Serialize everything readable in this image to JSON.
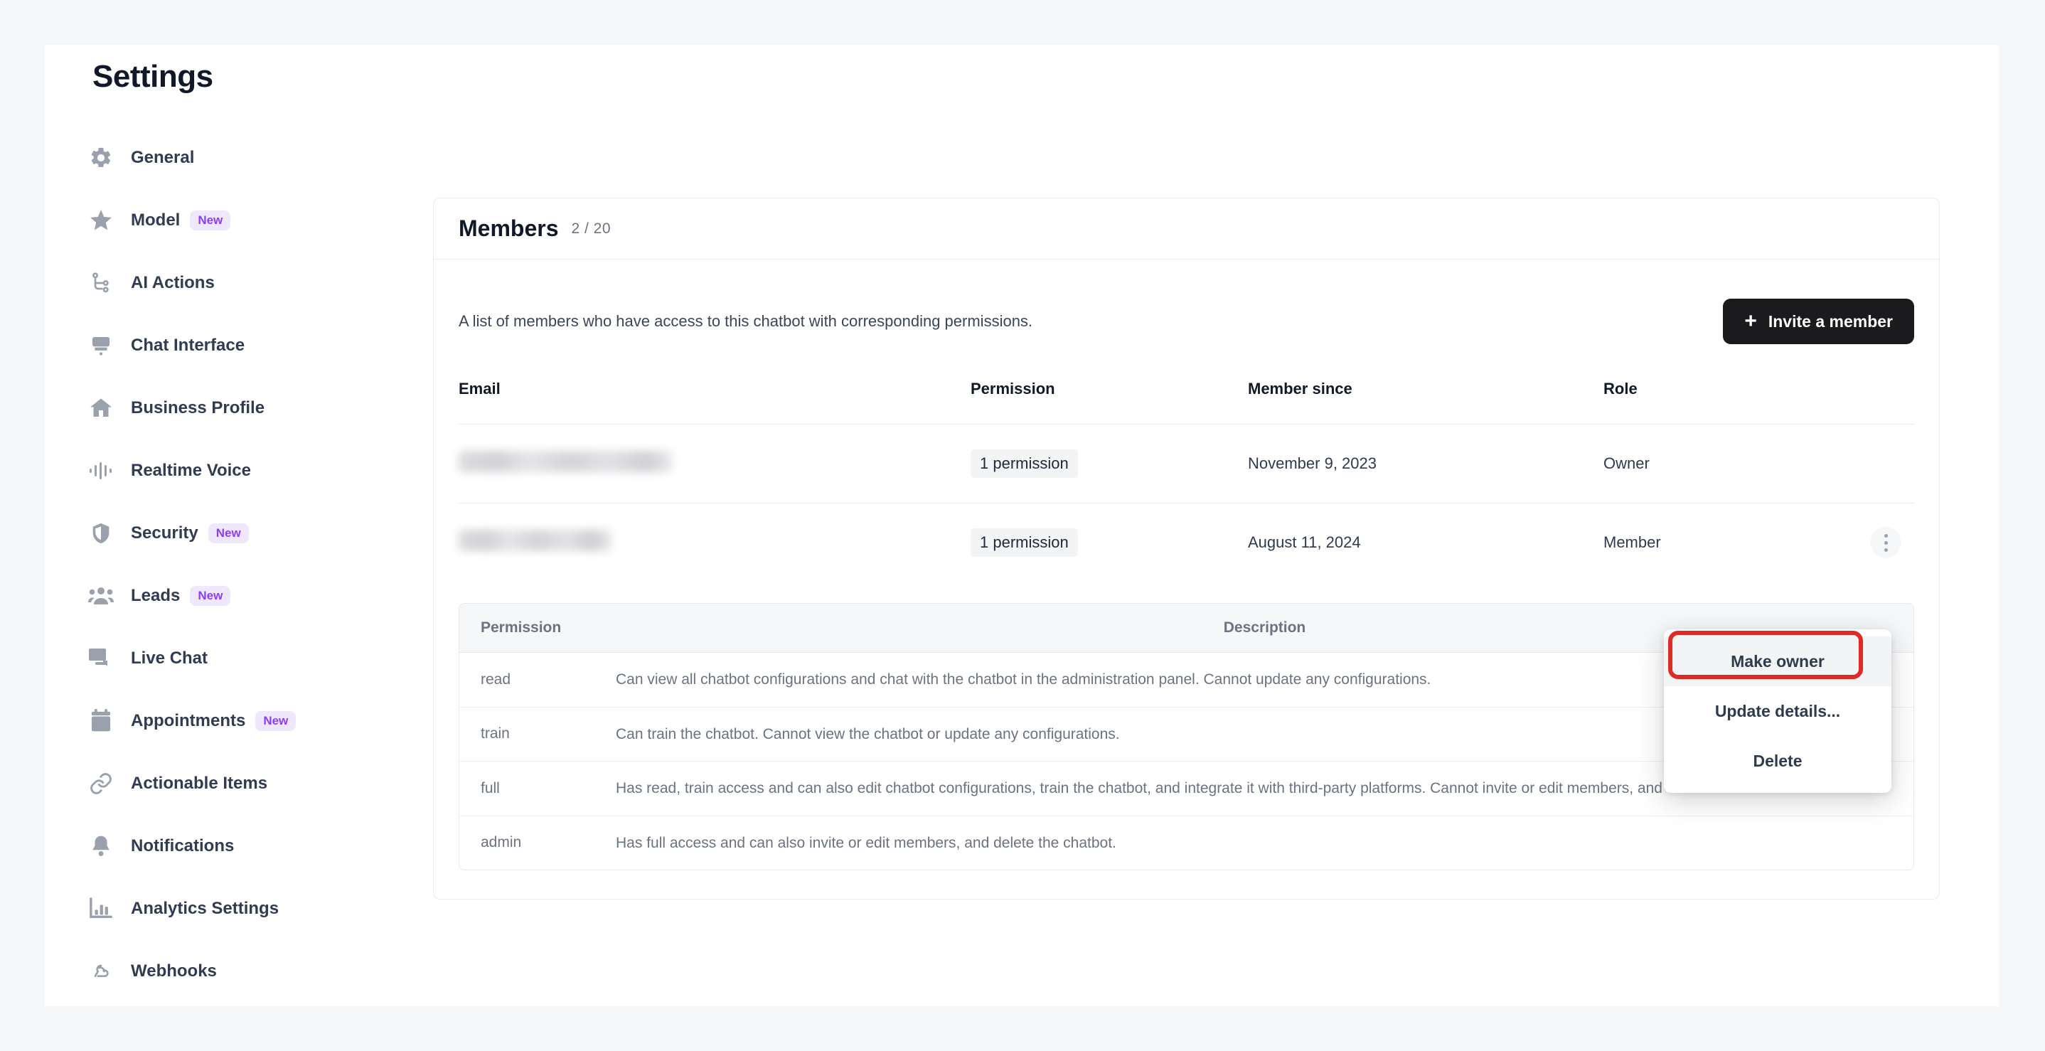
{
  "page": {
    "title": "Settings"
  },
  "sidebar": {
    "items": [
      {
        "label": "General",
        "icon": "gear-icon",
        "badge": null
      },
      {
        "label": "Model",
        "icon": "star-icon",
        "badge": "New"
      },
      {
        "label": "AI Actions",
        "icon": "workflow-icon",
        "badge": null
      },
      {
        "label": "Chat Interface",
        "icon": "paintbrush-icon",
        "badge": null
      },
      {
        "label": "Business Profile",
        "icon": "home-icon",
        "badge": null
      },
      {
        "label": "Realtime Voice",
        "icon": "waveform-icon",
        "badge": null
      },
      {
        "label": "Security",
        "icon": "shield-icon",
        "badge": "New"
      },
      {
        "label": "Leads",
        "icon": "people-icon",
        "badge": "New"
      },
      {
        "label": "Live Chat",
        "icon": "chat-bubbles-icon",
        "badge": null
      },
      {
        "label": "Appointments",
        "icon": "calendar-icon",
        "badge": "New"
      },
      {
        "label": "Actionable Items",
        "icon": "link-icon",
        "badge": null
      },
      {
        "label": "Notifications",
        "icon": "bell-icon",
        "badge": null
      },
      {
        "label": "Analytics Settings",
        "icon": "bar-chart-icon",
        "badge": null
      },
      {
        "label": "Webhooks",
        "icon": "webhook-icon",
        "badge": null
      }
    ]
  },
  "members_card": {
    "title": "Members",
    "count": "2 / 20",
    "description": "A list of members who have access to this chatbot with corresponding permissions.",
    "invite_button": "Invite a member",
    "invite_icon": "plus-icon",
    "columns": [
      "Email",
      "Permission",
      "Member since",
      "Role"
    ],
    "rows": [
      {
        "email": "",
        "email_redacted": true,
        "permission": "1 permission",
        "member_since": "November 9, 2023",
        "role": "Owner",
        "has_menu": false
      },
      {
        "email": "",
        "email_redacted": true,
        "permission": "1 permission",
        "member_since": "August 11, 2024",
        "role": "Member",
        "has_menu": true
      }
    ]
  },
  "permissions_table": {
    "columns": [
      "Permission",
      "Description"
    ],
    "rows": [
      {
        "name": "read",
        "description": "Can view all chatbot configurations and chat with the chatbot in the administration panel. Cannot update any configurations."
      },
      {
        "name": "train",
        "description": "Can train the chatbot. Cannot view the chatbot or update any configurations."
      },
      {
        "name": "full",
        "description": "Has read, train access and can also edit chatbot configurations, train the chatbot, and integrate it with third-party platforms. Cannot invite or edit members, and cannot delete the chatbot."
      },
      {
        "name": "admin",
        "description": "Has full access and can also invite or edit members, and delete the chatbot."
      }
    ]
  },
  "row_menu": {
    "items": [
      {
        "label": "Make owner",
        "highlighted": true
      },
      {
        "label": "Update details...",
        "highlighted": false
      },
      {
        "label": "Delete",
        "highlighted": false
      }
    ]
  },
  "colors": {
    "accent_badge_bg": "#efe8fd",
    "accent_badge_text": "#8b3ff5",
    "button_bg": "#1b1b1d",
    "highlight_outline": "#e02a26",
    "page_bg": "#f6f7f9",
    "border": "#e8eaee"
  }
}
